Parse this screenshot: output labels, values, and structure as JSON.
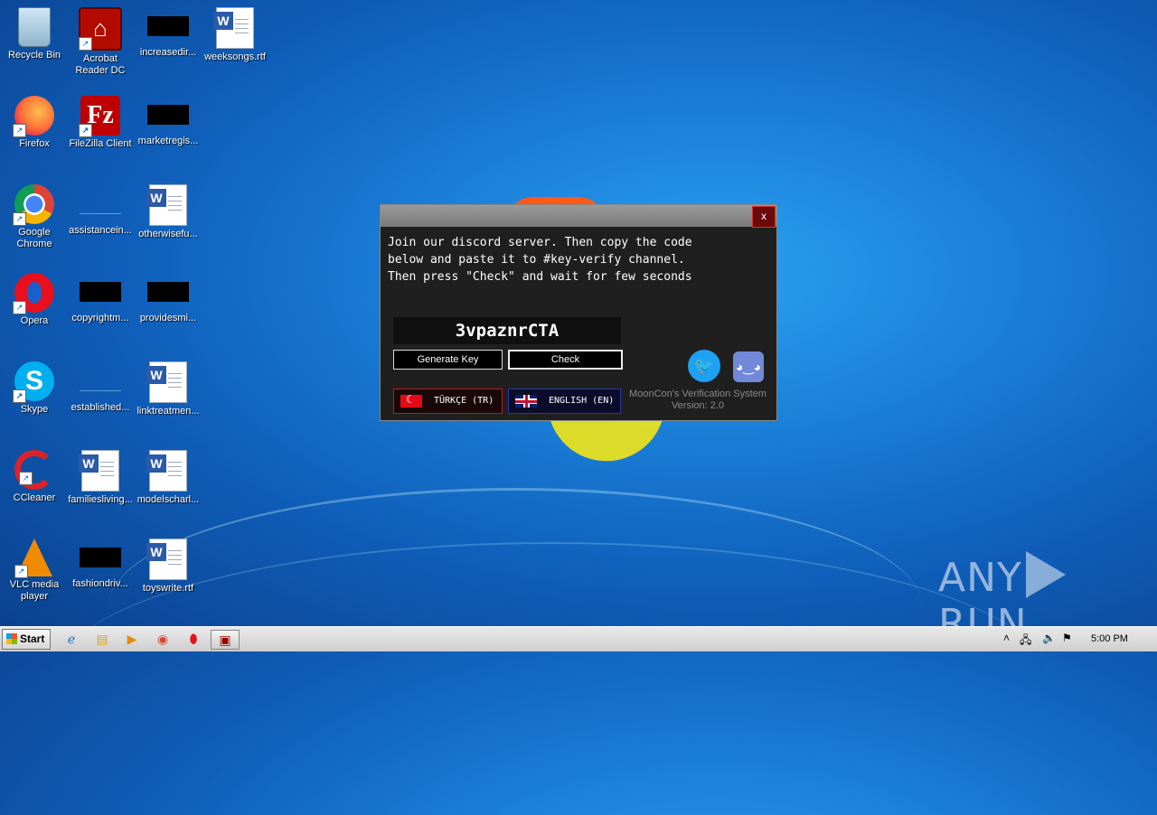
{
  "desktop": {
    "icons": [
      {
        "label": "Recycle Bin"
      },
      {
        "label": "Acrobat Reader DC"
      },
      {
        "label": "increasedir..."
      },
      {
        "label": "weeksongs.rtf"
      },
      {
        "label": "Firefox"
      },
      {
        "label": "FileZilla Client"
      },
      {
        "label": "marketregis..."
      },
      {
        "label": "Google Chrome"
      },
      {
        "label": "assistancein..."
      },
      {
        "label": "otherwisefu..."
      },
      {
        "label": "Opera"
      },
      {
        "label": "copyrightm..."
      },
      {
        "label": "providesmi..."
      },
      {
        "label": "Skype"
      },
      {
        "label": "established..."
      },
      {
        "label": "linktreatmen..."
      },
      {
        "label": "CCleaner"
      },
      {
        "label": "familiesliving..."
      },
      {
        "label": "modelscharl..."
      },
      {
        "label": "VLC media player"
      },
      {
        "label": "fashiondriv..."
      },
      {
        "label": "toyswrite.rtf"
      }
    ]
  },
  "dialog": {
    "close_label": "x",
    "message": "Join our discord server. Then copy the code\nbelow and paste it to #key-verify channel.\nThen press \"Check\" and wait for few seconds",
    "code": "3vpaznrCTA",
    "generate_label": "Generate Key",
    "check_label": "Check",
    "lang_tr": "TÜRKÇE (TR)",
    "lang_en": "ENGLISH (EN)",
    "system_name": "MoonCon's Verification System",
    "version": "Version: 2.0"
  },
  "watermark": {
    "left": "ANY",
    "right": "RUN"
  },
  "taskbar": {
    "start_label": "Start",
    "clock": "5:00 PM"
  },
  "colors": {
    "dialog_bg": "#1f1f1f",
    "close_bg": "#6b0a0a",
    "twitter": "#1da1f2",
    "discord": "#7289da"
  }
}
